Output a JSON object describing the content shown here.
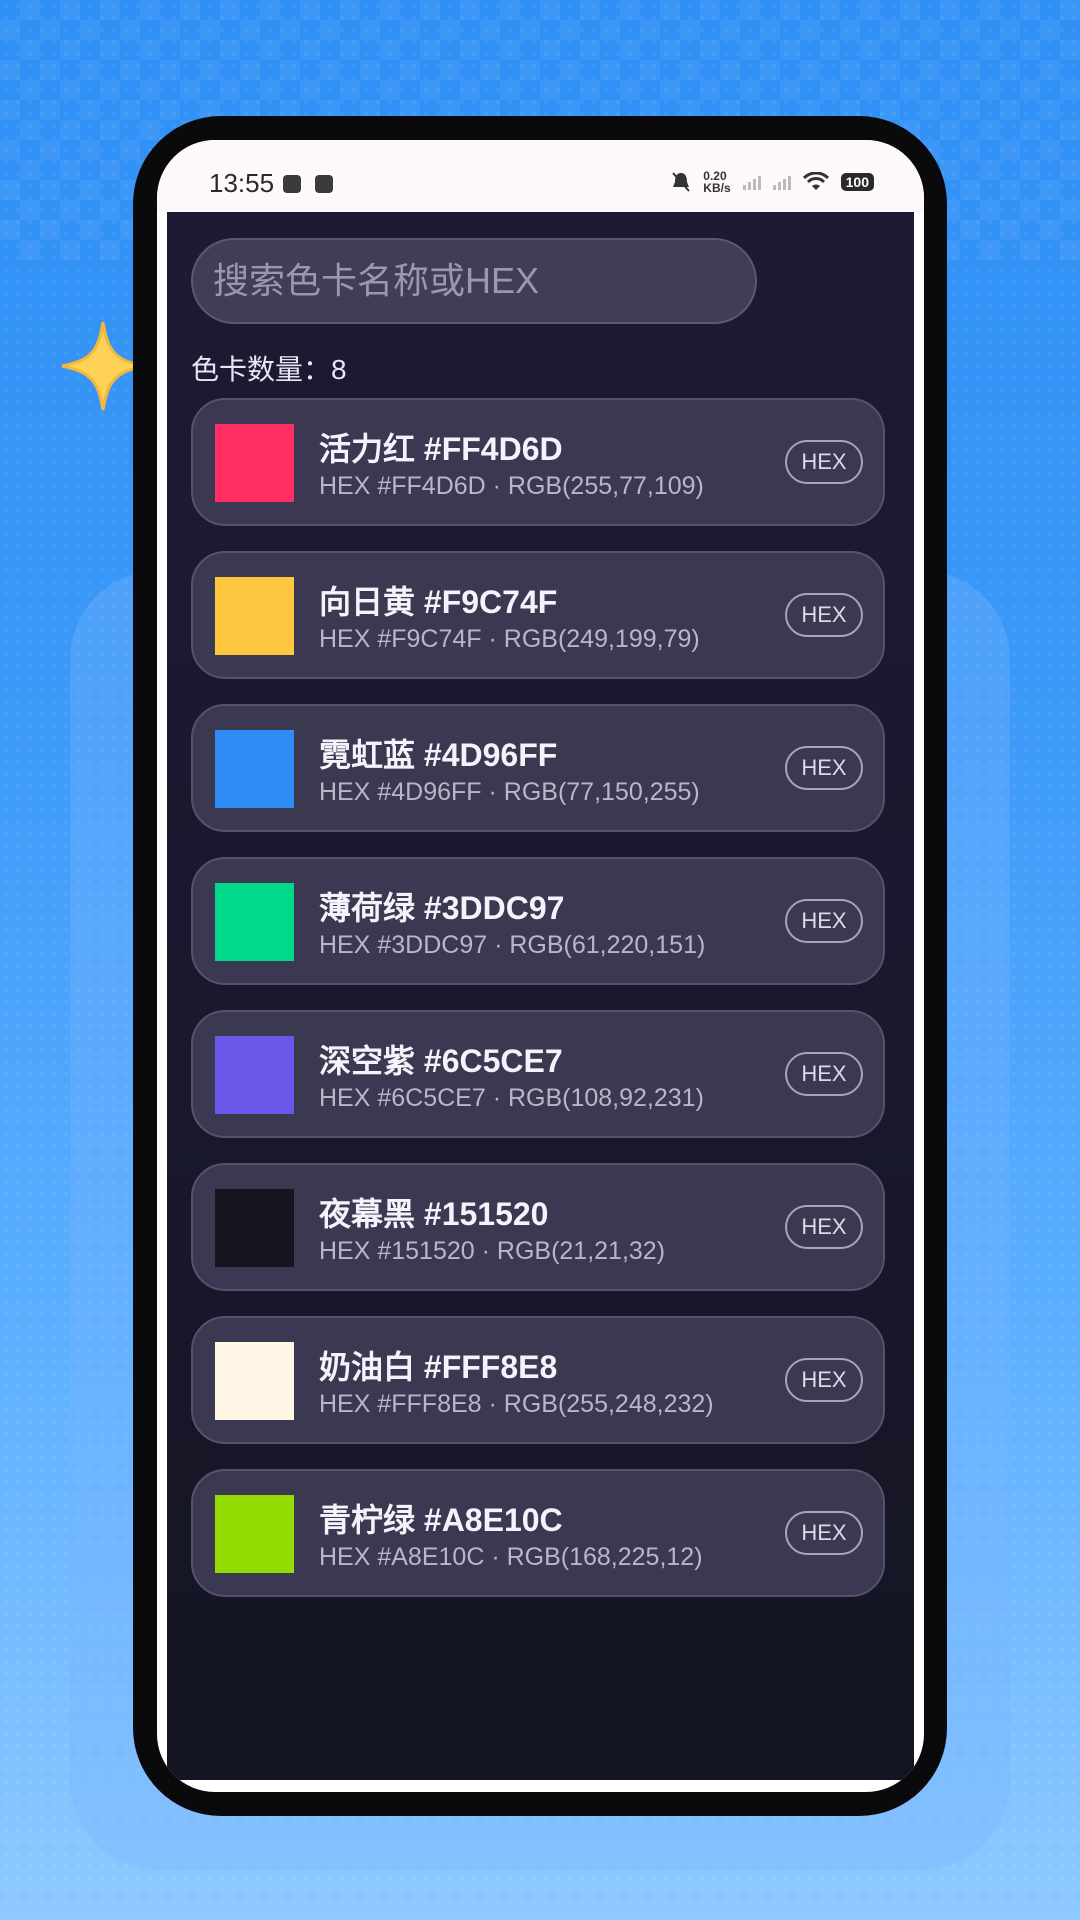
{
  "status_bar": {
    "time": "13:55",
    "net_speed_value": "0.20",
    "net_speed_unit": "KB/s",
    "battery": "100"
  },
  "search": {
    "placeholder": "搜索色卡名称或HEX"
  },
  "count_label": "色卡数量：8",
  "cards": [
    {
      "title": "活力红 #FF4D6D",
      "subtitle": "HEX #FF4D6D  ·  RGB(255,77,109)",
      "button": "HEX",
      "color": "#FF2E63"
    },
    {
      "title": "向日黄 #F9C74F",
      "subtitle": "HEX #F9C74F  ·  RGB(249,199,79)",
      "button": "HEX",
      "color": "#FFC63F"
    },
    {
      "title": "霓虹蓝 #4D96FF",
      "subtitle": "HEX #4D96FF  ·  RGB(77,150,255)",
      "button": "HEX",
      "color": "#2F8CF5"
    },
    {
      "title": "薄荷绿 #3DDC97",
      "subtitle": "HEX #3DDC97  ·  RGB(61,220,151)",
      "button": "HEX",
      "color": "#00D88A"
    },
    {
      "title": "深空紫 #6C5CE7",
      "subtitle": "HEX #6C5CE7  ·  RGB(108,92,231)",
      "button": "HEX",
      "color": "#6A58E8"
    },
    {
      "title": "夜幕黑 #151520",
      "subtitle": "HEX #151520  ·  RGB(21,21,32)",
      "button": "HEX",
      "color": "#151520"
    },
    {
      "title": "奶油白 #FFF8E8",
      "subtitle": "HEX #FFF8E8  ·  RGB(255,248,232)",
      "button": "HEX",
      "color": "#FFF6E6"
    },
    {
      "title": "青柠绿 #A8E10C",
      "subtitle": "HEX #A8E10C  ·  RGB(168,225,12)",
      "button": "HEX",
      "color": "#95DD00"
    }
  ]
}
